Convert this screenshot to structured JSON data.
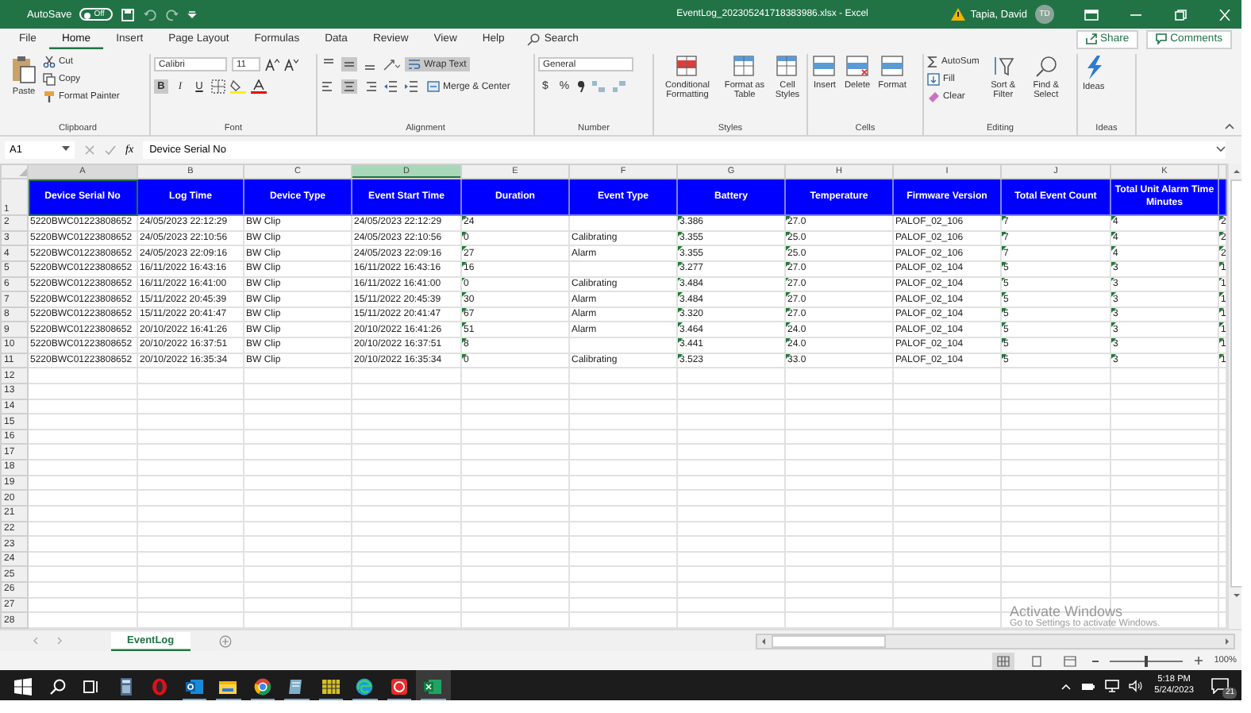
{
  "title_bar": {
    "autosave_label": "AutoSave",
    "autosave": {
      "on": false,
      "label": "Off"
    },
    "file_title": "EventLog_202305241718383986.xlsx  -  Excel",
    "user": "Tapia, David",
    "avatar": "TD"
  },
  "menu_tabs": [
    {
      "label": "File",
      "selected": false
    },
    {
      "label": "Home",
      "selected": true
    },
    {
      "label": "Insert",
      "selected": false
    },
    {
      "label": "Page Layout",
      "selected": false
    },
    {
      "label": "Formulas",
      "selected": false
    },
    {
      "label": "Data",
      "selected": false
    },
    {
      "label": "Review",
      "selected": false
    },
    {
      "label": "View",
      "selected": false
    },
    {
      "label": "Help",
      "selected": false
    }
  ],
  "search": {
    "placeholder": "Search"
  },
  "share": "Share",
  "comments": "Comments",
  "ribbon": {
    "clipboard": {
      "paste": "Paste",
      "cut": "Cut",
      "copy": "Copy",
      "format_painter": "Format Painter",
      "label": "Clipboard"
    },
    "font": {
      "name": "Calibri",
      "size": "11",
      "format_buttons": [
        {
          "label": "B",
          "selected": true
        },
        {
          "label": "I",
          "selected": false
        },
        {
          "label": "U",
          "selected": false
        }
      ],
      "label": "Font"
    },
    "alignment": {
      "vertical": [
        {
          "selected": false
        },
        {
          "selected": true
        },
        {
          "selected": false
        }
      ],
      "horizontal": [
        {
          "selected": false
        },
        {
          "selected": true
        },
        {
          "selected": false
        }
      ],
      "wrap_text": {
        "label": "Wrap Text",
        "on": true
      },
      "merge": "Merge & Center",
      "label": "Alignment"
    },
    "number": {
      "format": "General",
      "currency": "$",
      "percent": "%",
      "label": "Number"
    },
    "styles": {
      "buttons": [
        "Conditional Formatting",
        "Format as Table",
        "Cell Styles"
      ],
      "label": "Styles"
    },
    "cells": {
      "buttons": [
        "Insert",
        "Delete",
        "Format"
      ],
      "label": "Cells"
    },
    "editing": {
      "autosum": "AutoSum",
      "fill": "Fill",
      "clear": "Clear",
      "sort": "Sort & Filter",
      "find": "Find & Select",
      "label": "Editing"
    },
    "ideas": {
      "button": "Ideas",
      "label": "Ideas"
    }
  },
  "formula_bar": {
    "name_box": "A1",
    "function_label": "fx",
    "value": "Device Serial No"
  },
  "sheet": {
    "columns": [
      {
        "letter": "A",
        "header": "Device Serial No",
        "selected": false,
        "active": true,
        "text_numbers": false
      },
      {
        "letter": "B",
        "header": "Log Time",
        "selected": false,
        "active": false,
        "text_numbers": false
      },
      {
        "letter": "C",
        "header": "Device Type",
        "selected": false,
        "active": false,
        "text_numbers": false
      },
      {
        "letter": "D",
        "header": "Event Start Time",
        "selected": true,
        "active": false,
        "text_numbers": false
      },
      {
        "letter": "E",
        "header": "Duration",
        "selected": false,
        "active": false,
        "text_numbers": true
      },
      {
        "letter": "F",
        "header": "Event Type",
        "selected": false,
        "active": false,
        "text_numbers": false
      },
      {
        "letter": "G",
        "header": "Battery",
        "selected": false,
        "active": false,
        "text_numbers": true
      },
      {
        "letter": "H",
        "header": "Temperature",
        "selected": false,
        "active": false,
        "text_numbers": true
      },
      {
        "letter": "I",
        "header": "Firmware Version",
        "selected": false,
        "active": false,
        "text_numbers": false
      },
      {
        "letter": "J",
        "header": "Total Event Count",
        "selected": false,
        "active": false,
        "text_numbers": true
      },
      {
        "letter": "K",
        "header": "Total Unit Alarm Time Minutes",
        "selected": false,
        "active": false,
        "text_numbers": true
      }
    ],
    "rows": [
      [
        "5220BWC01223808652",
        "24/05/2023 22:12:29",
        "BW Clip",
        "24/05/2023 22:12:29",
        "24",
        null,
        "3.386",
        "27.0",
        "PALOF_02_106",
        "7",
        "4"
      ],
      [
        "5220BWC01223808652",
        "24/05/2023 22:10:56",
        "BW Clip",
        "24/05/2023 22:10:56",
        "0",
        "Calibrating",
        "3.355",
        "25.0",
        "PALOF_02_106",
        "7",
        "4"
      ],
      [
        "5220BWC01223808652",
        "24/05/2023 22:09:16",
        "BW Clip",
        "24/05/2023 22:09:16",
        "27",
        "Alarm",
        "3.355",
        "25.0",
        "PALOF_02_106",
        "7",
        "4"
      ],
      [
        "5220BWC01223808652",
        "16/11/2022 16:43:16",
        "BW Clip",
        "16/11/2022 16:43:16",
        "16",
        null,
        "3.277",
        "27.0",
        "PALOF_02_104",
        "5",
        "3"
      ],
      [
        "5220BWC01223808652",
        "16/11/2022 16:41:00",
        "BW Clip",
        "16/11/2022 16:41:00",
        "0",
        "Calibrating",
        "3.484",
        "27.0",
        "PALOF_02_104",
        "5",
        "3"
      ],
      [
        "5220BWC01223808652",
        "15/11/2022 20:45:39",
        "BW Clip",
        "15/11/2022 20:45:39",
        "30",
        "Alarm",
        "3.484",
        "27.0",
        "PALOF_02_104",
        "5",
        "3"
      ],
      [
        "5220BWC01223808652",
        "15/11/2022 20:41:47",
        "BW Clip",
        "15/11/2022 20:41:47",
        "67",
        "Alarm",
        "3.320",
        "27.0",
        "PALOF_02_104",
        "5",
        "3"
      ],
      [
        "5220BWC01223808652",
        "20/10/2022 16:41:26",
        "BW Clip",
        "20/10/2022 16:41:26",
        "51",
        "Alarm",
        "3.464",
        "24.0",
        "PALOF_02_104",
        "5",
        "3"
      ],
      [
        "5220BWC01223808652",
        "20/10/2022 16:37:51",
        "BW Clip",
        "20/10/2022 16:37:51",
        "8",
        null,
        "3.441",
        "24.0",
        "PALOF_02_104",
        "5",
        "3"
      ],
      [
        "5220BWC01223808652",
        "20/10/2022 16:35:34",
        "BW Clip",
        "20/10/2022 16:35:34",
        "0",
        "Calibrating",
        "3.523",
        "33.0",
        "PALOF_02_104",
        "5",
        "3"
      ]
    ],
    "cut_column": {
      "text_numbers": true,
      "values": [
        "2",
        "2",
        "2",
        "1",
        "1",
        "1",
        "1",
        "1",
        "1",
        "1"
      ]
    },
    "row_numbers": [
      "1",
      "2",
      "3",
      "4",
      "5",
      "6",
      "7",
      "8",
      "9",
      "10",
      "11",
      "12",
      "13",
      "14",
      "15",
      "16",
      "17",
      "18",
      "19",
      "20",
      "21",
      "22",
      "23",
      "24",
      "25",
      "26",
      "27",
      "28"
    ]
  },
  "sheet_tabs": [
    {
      "label": "EventLog",
      "selected": true
    }
  ],
  "activation_notice": {
    "title": "Activate Windows",
    "text": "Go to Settings to activate Windows."
  },
  "status_bar": {
    "zoom": "100%",
    "zoom_slider": {
      "level": 0.5
    }
  },
  "taskbar": {
    "apps": [
      {
        "running": false,
        "selected": false
      },
      {
        "running": false,
        "selected": false
      },
      {
        "running": false,
        "selected": false
      },
      {
        "running": false,
        "selected": false
      },
      {
        "running": false,
        "selected": false
      },
      {
        "running": true,
        "selected": false
      },
      {
        "running": true,
        "selected": false
      },
      {
        "running": true,
        "selected": false
      },
      {
        "running": true,
        "selected": false
      },
      {
        "running": true,
        "selected": false
      },
      {
        "running": true,
        "selected": false
      },
      {
        "running": true,
        "selected": false
      },
      {
        "running": true,
        "selected": true
      }
    ],
    "time": "5:18 PM",
    "date": "5/24/2023",
    "notifications": "21"
  }
}
